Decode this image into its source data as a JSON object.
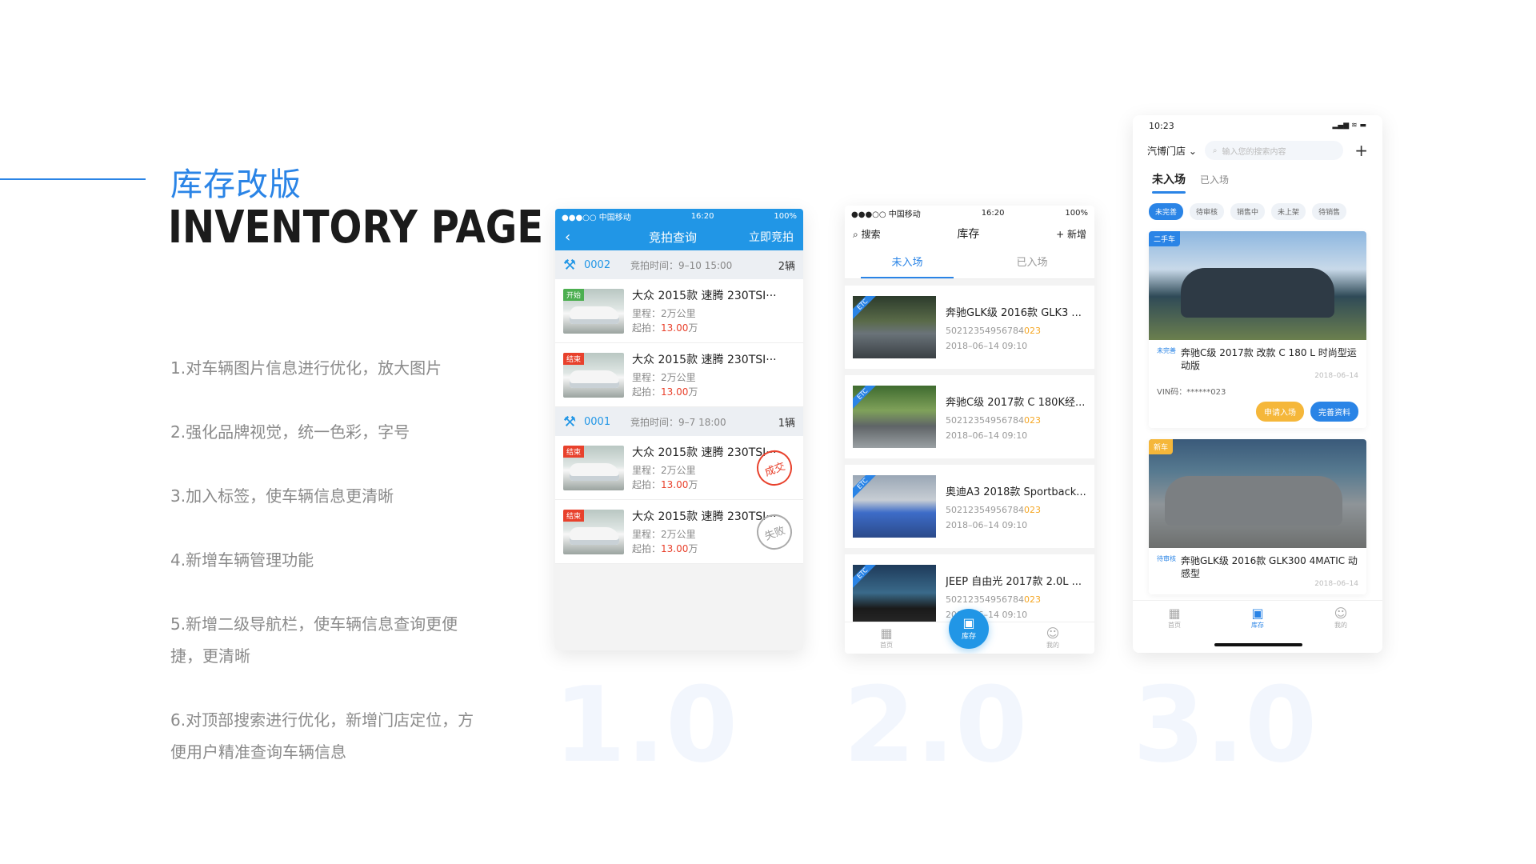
{
  "intro": {
    "title_cn": "库存改版",
    "title_en": "INVENTORY PAGE",
    "features": [
      "1.对车辆图片信息进行优化，放大图片",
      "2.强化品牌视觉，统一色彩，字号",
      "3.加入标签，使车辆信息更清晰",
      "4.新增车辆管理功能",
      "5.新增二级导航栏，使车辆信息查询更便捷，更清晰",
      "6.对顶部搜索进行优化，新增门店定位，方便用户精准查询车辆信息"
    ]
  },
  "versions": [
    "1.0",
    "2.0",
    "3.0"
  ],
  "colors": {
    "accent": "#2a84e6",
    "price": "#e8412c",
    "vin_highlight": "#f5a623"
  },
  "phone1": {
    "status": {
      "carrier": "●●●○○ 中国移动 ",
      "time": "16:20",
      "battery": "100%"
    },
    "nav": {
      "back_icon": "chevron-left-icon",
      "title": "竞拍查询",
      "right": "立即竞拍"
    },
    "groups": [
      {
        "code": "0002",
        "time": "竞拍时间：9–10 15:00",
        "count": "2辆",
        "items": [
          {
            "tag": "开始",
            "tag_color": "#4caf50",
            "car": "大众 2015款 速腾 230TSI···",
            "mileage": "里程：2万公里",
            "price_label": "起拍：",
            "price": "13.00",
            "unit": "万",
            "stamp": ""
          },
          {
            "tag": "结束",
            "tag_color": "#e8412c",
            "car": "大众 2015款 速腾 230TSI···",
            "mileage": "里程：2万公里",
            "price_label": "起拍：",
            "price": "13.00",
            "unit": "万",
            "stamp": ""
          }
        ]
      },
      {
        "code": "0001",
        "time": "竞拍时间：9–7 18:00",
        "count": "1辆",
        "items": [
          {
            "tag": "结束",
            "tag_color": "#e8412c",
            "car": "大众 2015款 速腾 230TSI···",
            "mileage": "里程：2万公里",
            "price_label": "起拍：",
            "price": "13.00",
            "unit": "万",
            "stamp": "成交"
          },
          {
            "tag": "结束",
            "tag_color": "#e8412c",
            "car": "大众 2015款 速腾 230TSI···",
            "mileage": "里程：2万公里",
            "price_label": "起拍：",
            "price": "13.00",
            "unit": "万",
            "stamp": "失败"
          }
        ]
      }
    ]
  },
  "phone2": {
    "status": {
      "carrier": "●●●○○ 中国移动 ",
      "time": "16:20",
      "battery": "100%"
    },
    "nav": {
      "search": "搜索",
      "title": "库存",
      "add": "新增"
    },
    "tabs": [
      "未入场",
      "已入场"
    ],
    "cards": [
      {
        "car": "奔驰GLK级 2016款 GLK3 ...",
        "vin_prefix": "50212354956784",
        "vin_suffix": "023",
        "date": "2018–06–14  09:10",
        "thumb": "linear-gradient(180deg,#2c3b2c 0%,#596a48 40%,#6a7379 60%,#3a4044 100%)"
      },
      {
        "car": "奔驰C级 2017款 C 180K经...",
        "vin_prefix": "50212354956784",
        "vin_suffix": "023",
        "date": "2018–06–14  09:10",
        "thumb": "linear-gradient(180deg,#3f6b2f 0%,#7fa15a 40%,#5f6467 65%,#9aa0a3 100%)"
      },
      {
        "car": "奥迪A3 2018款 Sportback...",
        "vin_prefix": "50212354956784",
        "vin_suffix": "023",
        "date": "2018–06–14  09:10",
        "thumb": "linear-gradient(180deg,#9aa7b5 0%,#c7cdd4 40%,#3d6cc8 60%,#2b4a8a 100%)"
      },
      {
        "car": "JEEP 自由光 2017款 2.0L ...",
        "vin_prefix": "50212354956784",
        "vin_suffix": "023",
        "date": "2018–06–14  09:10",
        "thumb": "linear-gradient(180deg,#1e3a5a 0%,#3a6a8a 45%,#1a1a1a 70%,#2a2a2a 100%)"
      }
    ],
    "tabbar": {
      "home": "首页",
      "inventory": "库存",
      "mine": "我的"
    }
  },
  "phone3": {
    "status": {
      "time": "10:23",
      "signal": "▂▄▆ ≋ ▬"
    },
    "store": "汽博门店",
    "search_placeholder": "输入您的搜索内容",
    "segments": [
      "未入场",
      "已入场"
    ],
    "chips": [
      "未完善",
      "待审核",
      "销售中",
      "未上架",
      "待销售"
    ],
    "listings": [
      {
        "corner": "二手车",
        "corner_color": "#2a84e6",
        "badge": "未完善",
        "name": "奔驰C级 2017款 改款 C 180 L 时尚型运动版",
        "date": "2018–06–14",
        "vin": "VIN码：******023",
        "btn1": "申请入场",
        "btn2": "完善资料"
      },
      {
        "corner": "新车",
        "corner_color": "#f5b73a",
        "badge": "待审核",
        "name": "奔驰GLK级 2016款 GLK300 4MATIC 动感型",
        "date": "2018–06–14"
      }
    ],
    "tabbar": {
      "home": "首页",
      "inventory": "库存",
      "mine": "我的"
    }
  }
}
